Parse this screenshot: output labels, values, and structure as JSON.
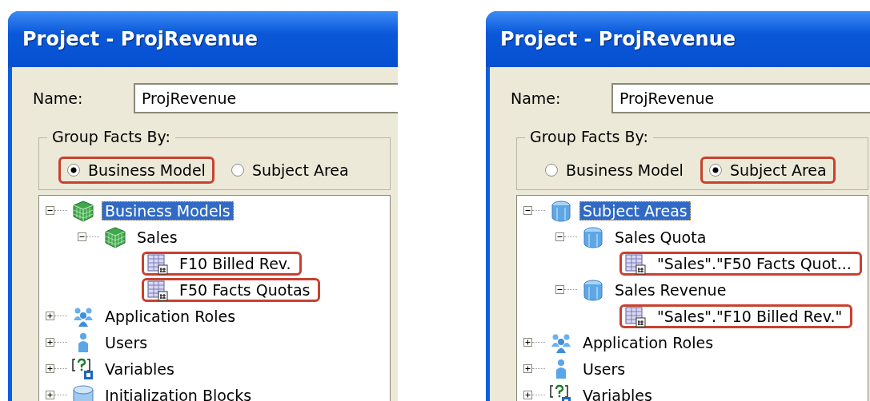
{
  "panels": [
    {
      "title": "Project - ProjRevenue",
      "name_label": "Name:",
      "name_value": "ProjRevenue",
      "group_label": "Group Facts By:",
      "options": [
        {
          "label": "Business Model",
          "selected": true,
          "highlighted": true
        },
        {
          "label": "Subject Area",
          "selected": false,
          "highlighted": false
        }
      ],
      "tree": [
        {
          "label": "Business Models",
          "kind": "business-model",
          "expanded": true,
          "selected": true,
          "highlighted": false,
          "children": [
            {
              "label": "Sales",
              "kind": "business-model",
              "expanded": true,
              "selected": false,
              "highlighted": false,
              "children": [
                {
                  "label": "F10 Billed Rev.",
                  "kind": "fact-table",
                  "selected": false,
                  "highlighted": true
                },
                {
                  "label": "F50 Facts Quotas",
                  "kind": "fact-table",
                  "selected": false,
                  "highlighted": true
                }
              ]
            }
          ]
        },
        {
          "label": "Application Roles",
          "kind": "roles",
          "expanded": false,
          "selected": false,
          "highlighted": false
        },
        {
          "label": "Users",
          "kind": "user",
          "expanded": false,
          "selected": false,
          "highlighted": false
        },
        {
          "label": "Variables",
          "kind": "variable",
          "expanded": false,
          "selected": false,
          "highlighted": false
        },
        {
          "label": "Initialization Blocks",
          "kind": "database",
          "expanded": false,
          "selected": false,
          "highlighted": false
        }
      ]
    },
    {
      "title": "Project - ProjRevenue",
      "name_label": "Name:",
      "name_value": "ProjRevenue",
      "group_label": "Group Facts By:",
      "options": [
        {
          "label": "Business Model",
          "selected": false,
          "highlighted": false
        },
        {
          "label": "Subject Area",
          "selected": true,
          "highlighted": true
        }
      ],
      "tree": [
        {
          "label": "Subject Areas",
          "kind": "subject-area",
          "expanded": true,
          "selected": true,
          "highlighted": false,
          "children": [
            {
              "label": "Sales Quota",
              "kind": "subject-area",
              "expanded": true,
              "selected": false,
              "highlighted": false,
              "children": [
                {
                  "label": "\"Sales\".\"F50 Facts Quot...",
                  "kind": "fact-table",
                  "selected": false,
                  "highlighted": true
                }
              ]
            },
            {
              "label": "Sales Revenue",
              "kind": "subject-area",
              "expanded": true,
              "selected": false,
              "highlighted": false,
              "children": [
                {
                  "label": "\"Sales\".\"F10 Billed Rev.\"",
                  "kind": "fact-table",
                  "selected": false,
                  "highlighted": true
                }
              ]
            }
          ]
        },
        {
          "label": "Application Roles",
          "kind": "roles",
          "expanded": false,
          "selected": false,
          "highlighted": false
        },
        {
          "label": "Users",
          "kind": "user",
          "expanded": false,
          "selected": false,
          "highlighted": false
        },
        {
          "label": "Variables",
          "kind": "variable",
          "expanded": false,
          "selected": false,
          "highlighted": false
        }
      ]
    }
  ]
}
